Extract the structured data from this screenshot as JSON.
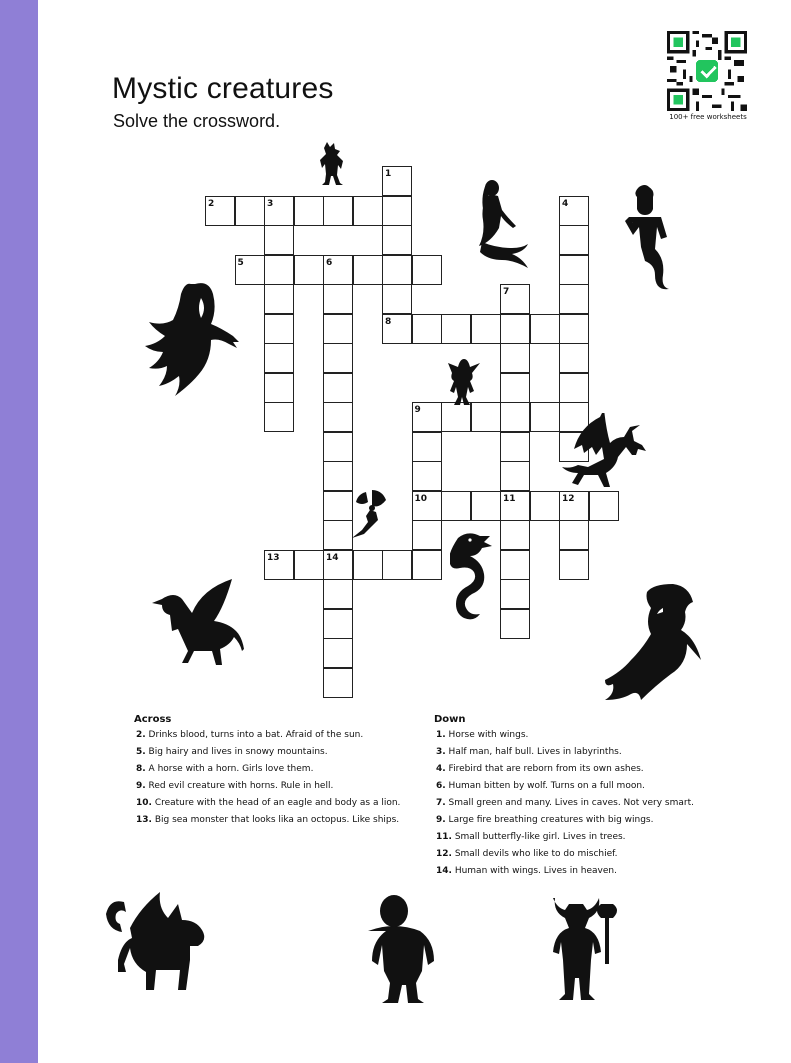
{
  "sheet": {
    "title": "Mystic creatures",
    "subtitle": "Solve the crossword.",
    "qr_caption": "100+ free worksheets"
  },
  "across": {
    "heading": "Across",
    "clues": [
      {
        "num": "2.",
        "text": "Drinks blood, turns into a bat. Afraid of the sun."
      },
      {
        "num": "5.",
        "text": "Big hairy and lives in snowy mountains."
      },
      {
        "num": "8.",
        "text": "A horse with a horn. Girls love them."
      },
      {
        "num": "9.",
        "text": "Red evil creature with horns. Rule in hell."
      },
      {
        "num": "10.",
        "text": "Creature with the head of an eagle and body as a lion."
      },
      {
        "num": "13.",
        "text": "Big sea monster that looks lika an octopus. Like ships."
      }
    ]
  },
  "down": {
    "heading": "Down",
    "clues": [
      {
        "num": "1.",
        "text": "Horse with wings."
      },
      {
        "num": "3.",
        "text": "Half man, half bull. Lives in labyrinths."
      },
      {
        "num": "4.",
        "text": "Firebird that are reborn from its own ashes."
      },
      {
        "num": "6.",
        "text": "Human bitten by wolf. Turns on a full moon."
      },
      {
        "num": "7.",
        "text": "Small green and many. Lives in caves. Not very smart."
      },
      {
        "num": "9.",
        "text": "Large fire breathing creatures with big wings."
      },
      {
        "num": "11.",
        "text": "Small butterfly-like girl. Lives in trees."
      },
      {
        "num": "12.",
        "text": "Small devils who like to do mischief."
      },
      {
        "num": "14.",
        "text": "Human with wings. Lives in heaven."
      }
    ]
  },
  "grid_numbers": [
    "1",
    "2",
    "3",
    "4",
    "5",
    "6",
    "7",
    "8",
    "9",
    "10",
    "11",
    "12",
    "13",
    "14"
  ],
  "creature_icons": [
    "werewolf-icon",
    "mermaid-icon",
    "genie-icon",
    "ghost-icon",
    "goblin-icon",
    "dragon-icon",
    "fairy-icon",
    "sea-serpent-icon",
    "griffin-icon",
    "fire-spirit-icon",
    "manticore-icon",
    "troll-icon",
    "minotaur-icon"
  ]
}
